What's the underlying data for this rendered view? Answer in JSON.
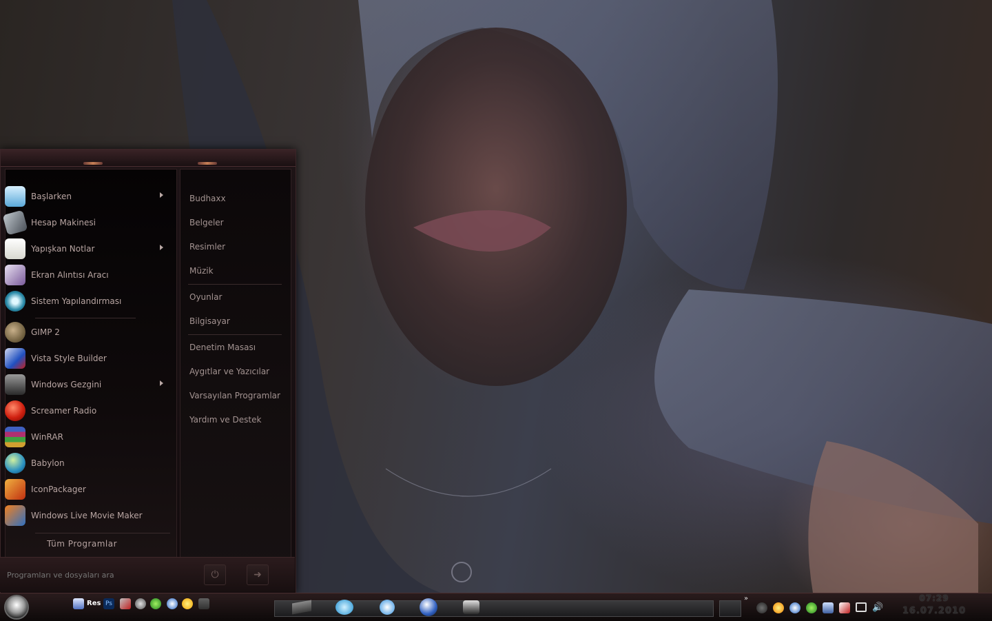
{
  "start_menu": {
    "programs": [
      {
        "label": "Başlarken",
        "icon": "getting-started-icon",
        "has_submenu": true
      },
      {
        "label": "Hesap Makinesi",
        "icon": "calculator-icon",
        "has_submenu": false
      },
      {
        "label": "Yapışkan Notlar",
        "icon": "sticky-notes-icon",
        "has_submenu": true
      },
      {
        "label": "Ekran Alıntısı Aracı",
        "icon": "snipping-tool-icon",
        "has_submenu": false
      },
      {
        "label": "Sistem Yapılandırması",
        "icon": "system-config-icon",
        "has_submenu": false
      },
      {
        "label": "GIMP 2",
        "icon": "gimp-icon",
        "has_submenu": false
      },
      {
        "label": "Vista Style Builder",
        "icon": "vista-style-builder-icon",
        "has_submenu": false
      },
      {
        "label": "Windows Gezgini",
        "icon": "windows-explorer-icon",
        "has_submenu": true
      },
      {
        "label": "Screamer Radio",
        "icon": "screamer-radio-icon",
        "has_submenu": false
      },
      {
        "label": "WinRAR",
        "icon": "winrar-icon",
        "has_submenu": false
      },
      {
        "label": "Babylon",
        "icon": "babylon-icon",
        "has_submenu": false
      },
      {
        "label": "IconPackager",
        "icon": "iconpackager-icon",
        "has_submenu": false
      },
      {
        "label": "Windows Live Movie Maker",
        "icon": "movie-maker-icon",
        "has_submenu": false
      }
    ],
    "all_programs": "Tüm Programlar",
    "search_placeholder": "Programları ve dosyaları ara",
    "places": [
      "Budhaxx",
      "Belgeler",
      "Resimler",
      "Müzik",
      "Oyunlar",
      "Bilgisayar",
      "Denetim Masası",
      "Aygıtlar ve Yazıcılar",
      "Varsayılan Programlar",
      "Yardım ve Destek"
    ]
  },
  "taskbar": {
    "quick_launch": [
      {
        "icon": "notepad-icon",
        "label": ""
      },
      {
        "icon": "reshacker-icon",
        "label": "Res"
      },
      {
        "icon": "photoshop-icon",
        "label": "Ps"
      },
      {
        "icon": "tools-icon",
        "label": ""
      },
      {
        "icon": "alien-icon",
        "label": ""
      },
      {
        "icon": "msn-icon",
        "label": ""
      },
      {
        "icon": "babylon-small-icon",
        "label": ""
      },
      {
        "icon": "smiley-icon",
        "label": ""
      },
      {
        "icon": "eject-icon",
        "label": ""
      }
    ],
    "clock": {
      "time": "07:29",
      "date": "16.07.2010"
    }
  }
}
